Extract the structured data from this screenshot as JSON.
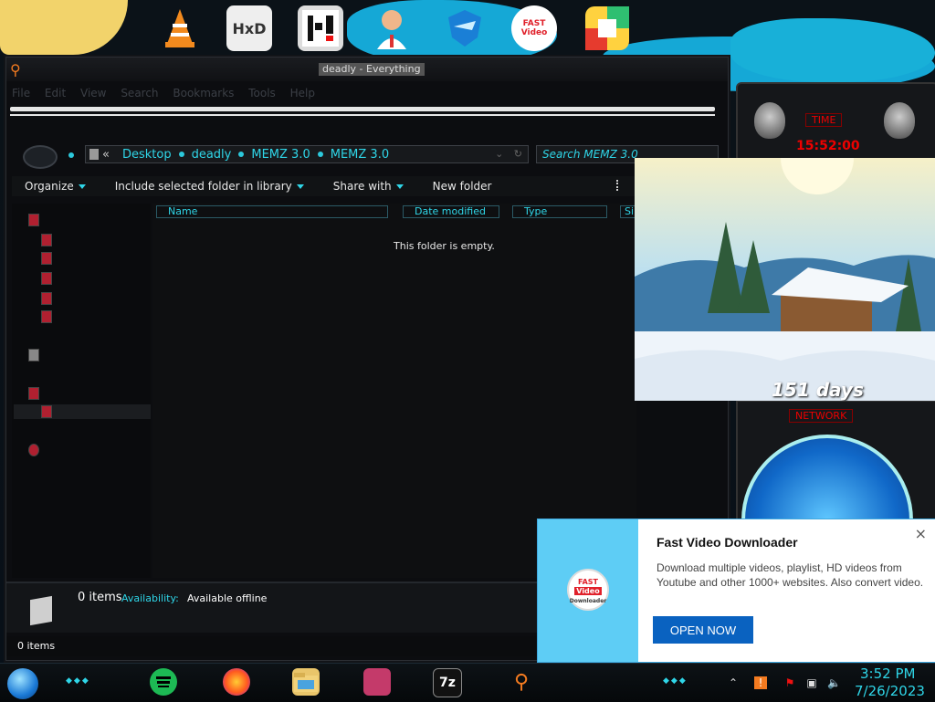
{
  "window": {
    "title": "deadly - Everything",
    "menu": [
      "File",
      "Edit",
      "View",
      "Search",
      "Bookmarks",
      "Tools",
      "Help"
    ]
  },
  "address": {
    "root": "«",
    "crumbs": [
      "Desktop",
      "deadly",
      "MEMZ 3.0",
      "MEMZ 3.0"
    ],
    "search_placeholder": "Search MEMZ 3.0"
  },
  "toolbar": {
    "organize": "Organize",
    "include": "Include selected folder in library",
    "share": "Share with",
    "new_folder": "New folder"
  },
  "columns": [
    "Name",
    "Date modified",
    "Type",
    "Si"
  ],
  "content": {
    "empty_message": "This folder is empty."
  },
  "details": {
    "count": "0 items",
    "availability_label": "Availability:",
    "availability_value": "Available offline"
  },
  "status": {
    "text": "0 items"
  },
  "gadgets": {
    "time_label": "TIME",
    "time_digits": "15:52:00",
    "network_label": "NETWORK",
    "countdown_text": "151 days"
  },
  "popup": {
    "title": "Fast Video Downloader",
    "body": "Download multiple videos, playlist, HD videos from Youtube and other 1000+ websites. Also convert video.",
    "button": "OPEN NOW",
    "close": "×",
    "logo_line1": "FAST",
    "logo_line2": "Video",
    "logo_line3": "Downloader"
  },
  "taskbar": {
    "time": "3:52 PM",
    "date": "7/26/2023"
  },
  "colors": {
    "accent": "#2fd6e8",
    "popup_button": "#0a62c0",
    "alert_red": "#e00000"
  }
}
